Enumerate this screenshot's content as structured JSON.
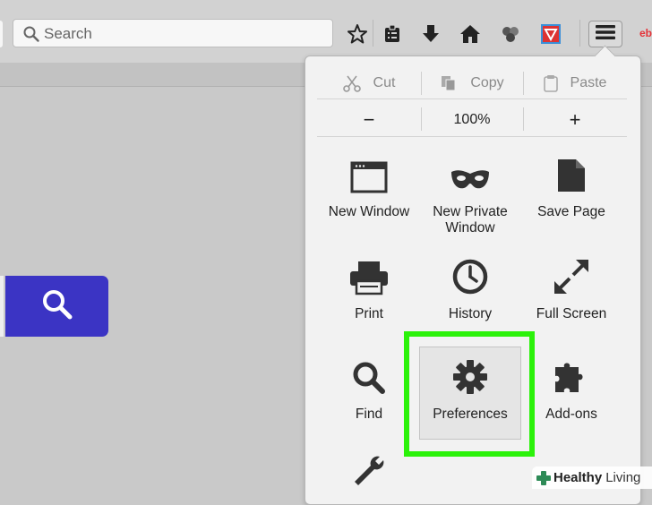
{
  "toolbar": {
    "search_placeholder": "Search",
    "icons": [
      "bookmark-star-icon",
      "reading-list-icon",
      "download-icon",
      "home-icon",
      "pocket-icon",
      "pdf-extension-icon",
      "hamburger-menu-icon"
    ],
    "ebay_label": "eb"
  },
  "menu": {
    "edit": {
      "cut": "Cut",
      "copy": "Copy",
      "paste": "Paste"
    },
    "zoom": {
      "out": "−",
      "level": "100%",
      "in": "+"
    },
    "items": [
      {
        "label": "New Window",
        "icon": "window-icon"
      },
      {
        "label": "New Private\nWindow",
        "icon": "mask-icon"
      },
      {
        "label": "Save Page",
        "icon": "page-icon"
      },
      {
        "label": "Print",
        "icon": "printer-icon"
      },
      {
        "label": "History",
        "icon": "clock-icon"
      },
      {
        "label": "Full Screen",
        "icon": "expand-icon"
      },
      {
        "label": "Find",
        "icon": "magnifier-icon"
      },
      {
        "label": "Preferences",
        "icon": "gear-icon"
      },
      {
        "label": "Add-ons",
        "icon": "puzzle-icon"
      },
      {
        "label": "",
        "icon": "wrench-icon"
      }
    ]
  },
  "highlight_color": "#2bf20a",
  "page_search_color": "#3b34c4",
  "watermark": {
    "part1": "Healthy",
    "part2": "Living"
  }
}
